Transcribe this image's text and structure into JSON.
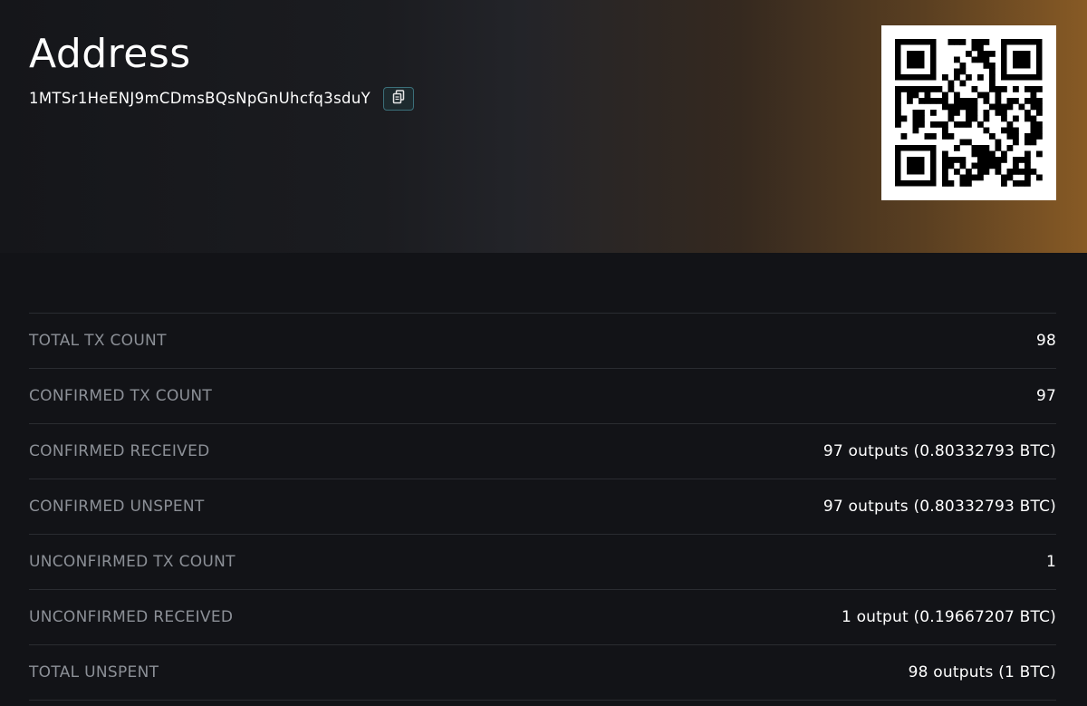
{
  "header": {
    "title": "Address",
    "address": "1MTSr1HeENJ9mCDmsBQsNpGnUhcfq3sduY",
    "copy_icon": "copy-icon",
    "qr_icon": "qr-code"
  },
  "colors": {
    "background": "#121317",
    "gradient_accent": "#875a25",
    "label": "#8c9097",
    "value": "#ffffff",
    "copy_border": "#3b6f79"
  },
  "stats": [
    {
      "label": "TOTAL TX COUNT",
      "value": "98"
    },
    {
      "label": "CONFIRMED TX COUNT",
      "value": "97"
    },
    {
      "label": "CONFIRMED RECEIVED",
      "value": "97 outputs (0.80332793 BTC)"
    },
    {
      "label": "CONFIRMED UNSPENT",
      "value": "97 outputs (0.80332793 BTC)"
    },
    {
      "label": "UNCONFIRMED TX COUNT",
      "value": "1"
    },
    {
      "label": "UNCONFIRMED RECEIVED",
      "value": "1 output (0.19667207 BTC)"
    },
    {
      "label": "TOTAL UNSPENT",
      "value": "98 outputs (1 BTC)"
    }
  ]
}
